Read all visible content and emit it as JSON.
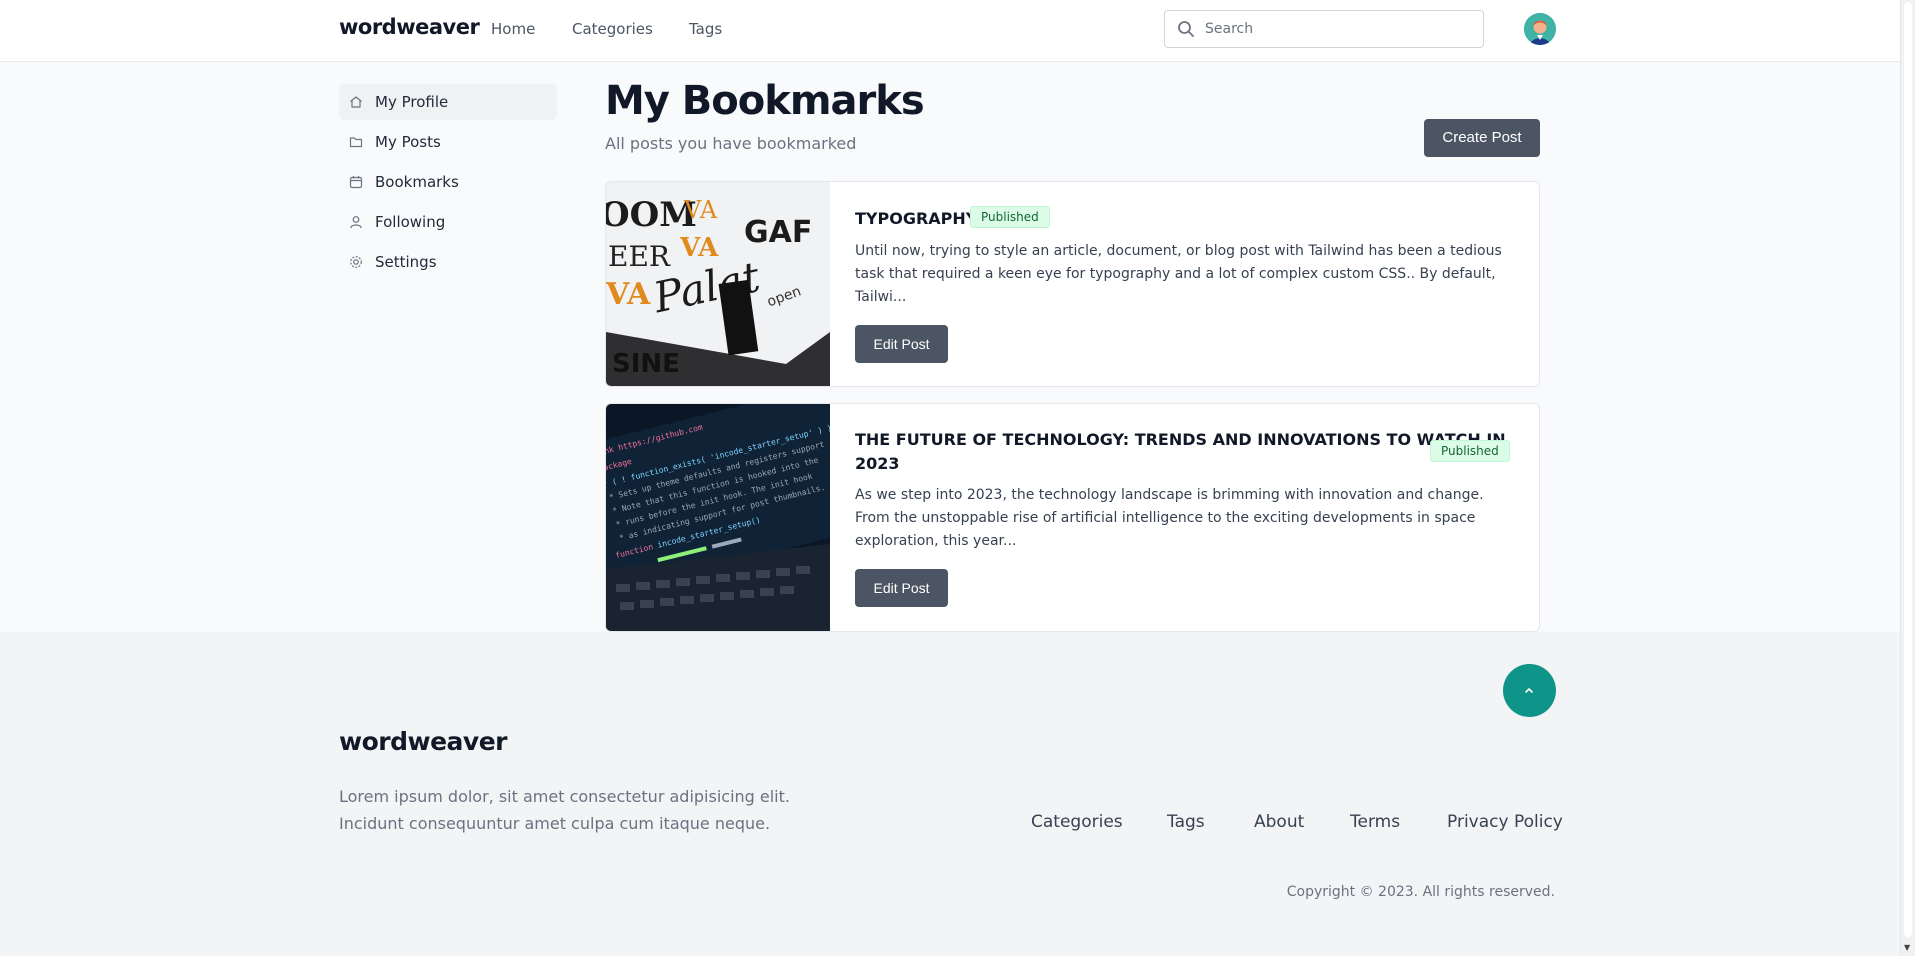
{
  "header": {
    "logo": "wordweaver",
    "nav": [
      "Home",
      "Categories",
      "Tags"
    ],
    "search_placeholder": "Search"
  },
  "sidebar": {
    "items": [
      {
        "label": "My Profile",
        "icon": "home-icon",
        "active": true
      },
      {
        "label": "My Posts",
        "icon": "folder-icon",
        "active": false
      },
      {
        "label": "Bookmarks",
        "icon": "calendar-icon",
        "active": false
      },
      {
        "label": "Following",
        "icon": "users-icon",
        "active": false
      },
      {
        "label": "Settings",
        "icon": "gear-icon",
        "active": false
      }
    ]
  },
  "main": {
    "title": "My Bookmarks",
    "subtitle": "All posts you have bookmarked",
    "create_label": "Create Post",
    "posts": [
      {
        "title": "TYPOGRAPHY",
        "status": "Published",
        "excerpt": "Until now, trying to style an article, document, or blog post with Tailwind has been a tedious task that required a keen eye for typography and a lot of complex custom CSS.. By default, Tailwi...",
        "edit_label": "Edit Post",
        "image": "typography-image"
      },
      {
        "title_line1": "THE FUTURE OF TECHNOLOGY: TRENDS AND INNOVATIONS TO WATCH IN",
        "title_line2": "2023",
        "status": "Published",
        "excerpt": "As we step into 2023, the technology landscape is brimming with innovation and change. From the unstoppable rise of artificial intelligence to the exciting developments in space exploration, this year...",
        "edit_label": "Edit Post",
        "image": "code-laptop-image"
      }
    ]
  },
  "footer": {
    "logo": "wordweaver",
    "description": "Lorem ipsum dolor, sit amet consectetur adipisicing elit. Incidunt consequuntur amet culpa cum itaque neque.",
    "links": [
      "Categories",
      "Tags",
      "About",
      "Terms",
      "Privacy Policy"
    ],
    "copyright": "Copyright © 2023. All rights reserved."
  },
  "colors": {
    "accent": "#0e9488",
    "button": "#4b5563",
    "badge_bg": "#dcfce7",
    "badge_text": "#166534"
  }
}
